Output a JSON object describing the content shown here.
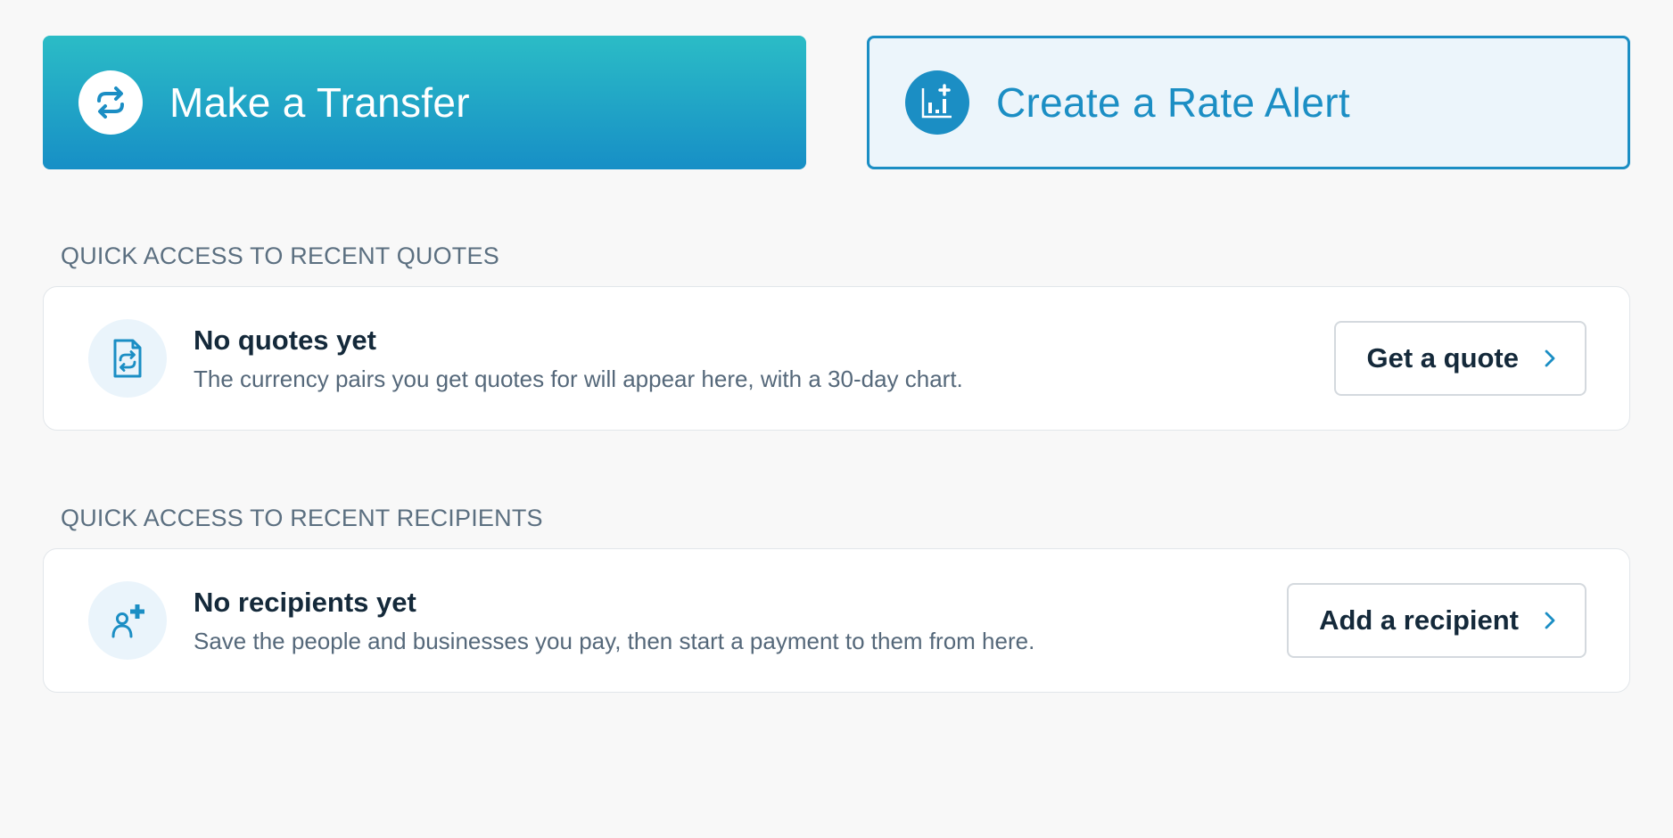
{
  "actions": {
    "transfer_label": "Make a Transfer",
    "rate_alert_label": "Create a Rate Alert"
  },
  "quotes": {
    "heading": "QUICK ACCESS TO RECENT QUOTES",
    "title": "No quotes yet",
    "description": "The currency pairs you get quotes for will appear here, with a 30-day chart.",
    "button_label": "Get a quote"
  },
  "recipients": {
    "heading": "QUICK ACCESS TO RECENT RECIPIENTS",
    "title": "No recipients yet",
    "description": "Save the people and businesses you pay, then start a payment to them from here.",
    "button_label": "Add a recipient"
  },
  "icons": {
    "transfer": "transfer-arrows-icon",
    "rate_alert": "rate-alert-chart-icon",
    "quote": "quote-document-icon",
    "recipient": "add-person-icon",
    "chevron": "chevron-right-icon"
  },
  "colors": {
    "primary_gradient_start": "#2bbcc6",
    "primary_gradient_end": "#178fc6",
    "accent": "#1b8ec4",
    "secondary_bg": "#ecf5fb",
    "page_bg": "#f8f8f8"
  }
}
